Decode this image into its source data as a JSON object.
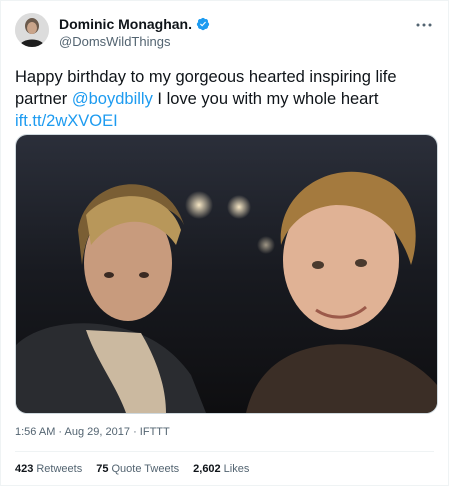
{
  "author": {
    "display_name": "Dominic Monaghan.",
    "handle": "@DomsWildThings",
    "verified": true
  },
  "tweet": {
    "text_before_mention": "Happy birthday to my gorgeous hearted inspiring life partner ",
    "mention": "@boydbilly",
    "text_after_mention": " I love you with my whole heart",
    "link": "ift.tt/2wXVOEI"
  },
  "meta": {
    "time": "1:56 AM",
    "separator": "·",
    "date": "Aug 29, 2017",
    "source": "IFTTT"
  },
  "stats": {
    "retweets_count": "423",
    "retweets_label": "Retweets",
    "quotes_count": "75",
    "quotes_label": "Quote Tweets",
    "likes_count": "2,602",
    "likes_label": "Likes"
  },
  "colors": {
    "link": "#1d9bf0",
    "secondary_text": "#536471",
    "verified_badge": "#1d9bf0"
  },
  "icons": [
    "verified-badge-icon",
    "more-options-icon"
  ]
}
